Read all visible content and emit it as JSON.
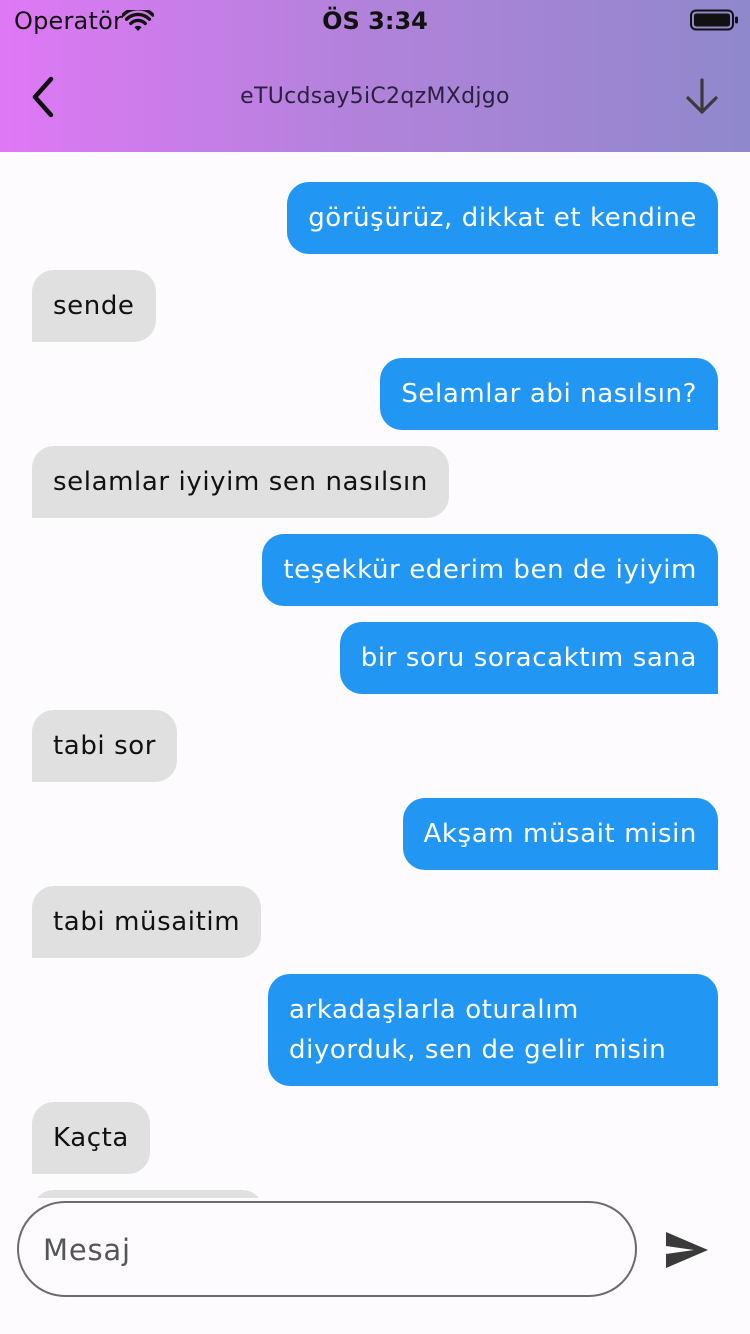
{
  "status_bar": {
    "carrier": "Operatör",
    "time": "ÖS 3:34"
  },
  "header": {
    "title": "eTUcdsay5iC2qzMXdjgo",
    "back_icon": "chevron-left-icon",
    "action_icon": "arrow-down-icon"
  },
  "messages": [
    {
      "side": "sent",
      "text": "görüşürüz, dikkat et kendine"
    },
    {
      "side": "recv",
      "text": "sende"
    },
    {
      "side": "sent",
      "text": "Selamlar abi nasılsın?"
    },
    {
      "side": "recv",
      "text": "selamlar iyiyim sen nasılsın"
    },
    {
      "side": "sent",
      "text": "teşekkür ederim ben de iyiyim"
    },
    {
      "side": "sent",
      "text": "bir soru soracaktım sana"
    },
    {
      "side": "recv",
      "text": "tabi sor"
    },
    {
      "side": "sent",
      "text": "Akşam müsait misin"
    },
    {
      "side": "recv",
      "text": "tabi müsaitim"
    },
    {
      "side": "sent",
      "text": "arkadaşlarla oturalım diyorduk, sen de gelir misin"
    },
    {
      "side": "recv",
      "text": "Kaçta"
    }
  ],
  "composer": {
    "placeholder": "Mesaj",
    "value": "",
    "send_icon": "send-icon"
  },
  "colors": {
    "sent_bubble": "#2196f3",
    "received_bubble": "#e0e0e0",
    "header_gradient_start": "#df78f5",
    "header_gradient_end": "#8f88cc"
  }
}
